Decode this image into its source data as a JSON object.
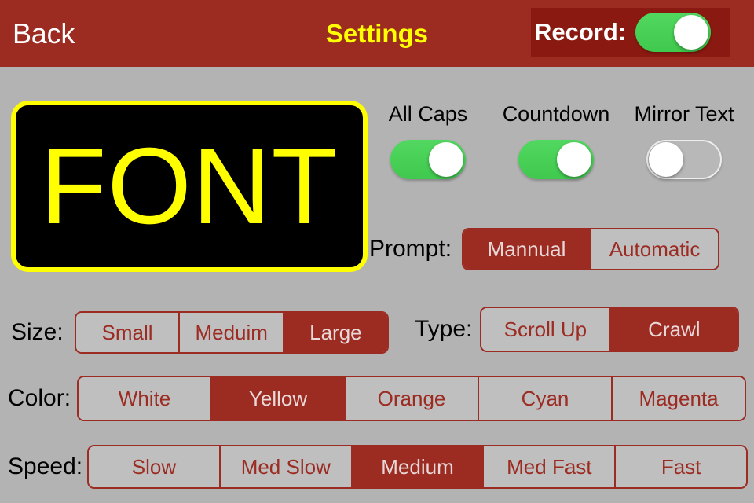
{
  "navbar": {
    "back_label": "Back",
    "title": "Settings",
    "record_label": "Record:",
    "record_on": true,
    "bar_color": "#9c2b22",
    "title_color": "#ffff00",
    "record_box_color": "#8a1a11"
  },
  "preview": {
    "text": "FONT",
    "text_color": "#ffff00",
    "background_color": "#000000",
    "border_color": "#ffff00"
  },
  "toggles": [
    {
      "label": "All Caps",
      "state": "on"
    },
    {
      "label": "Countdown",
      "state": "on"
    },
    {
      "label": "Mirror Text",
      "state": "off"
    }
  ],
  "prompt": {
    "label": "Prompt:",
    "options": [
      "Mannual",
      "Automatic"
    ],
    "selected_index": 0
  },
  "size": {
    "label": "Size:",
    "options": [
      "Small",
      "Meduim",
      "Large"
    ],
    "selected_index": 2
  },
  "type": {
    "label": "Type:",
    "options": [
      "Scroll Up",
      "Crawl"
    ],
    "selected_index": 1
  },
  "color": {
    "label": "Color:",
    "options": [
      "White",
      "Yellow",
      "Orange",
      "Cyan",
      "Magenta"
    ],
    "selected_index": 1
  },
  "speed": {
    "label": "Speed:",
    "options": [
      "Slow",
      "Med Slow",
      "Medium",
      "Med Fast",
      "Fast"
    ],
    "selected_index": 2
  },
  "theme": {
    "accent": "#9c2b22",
    "background": "#b3b3b3",
    "switch_on": "#4bd159",
    "switch_off": "#b8b8b8"
  }
}
